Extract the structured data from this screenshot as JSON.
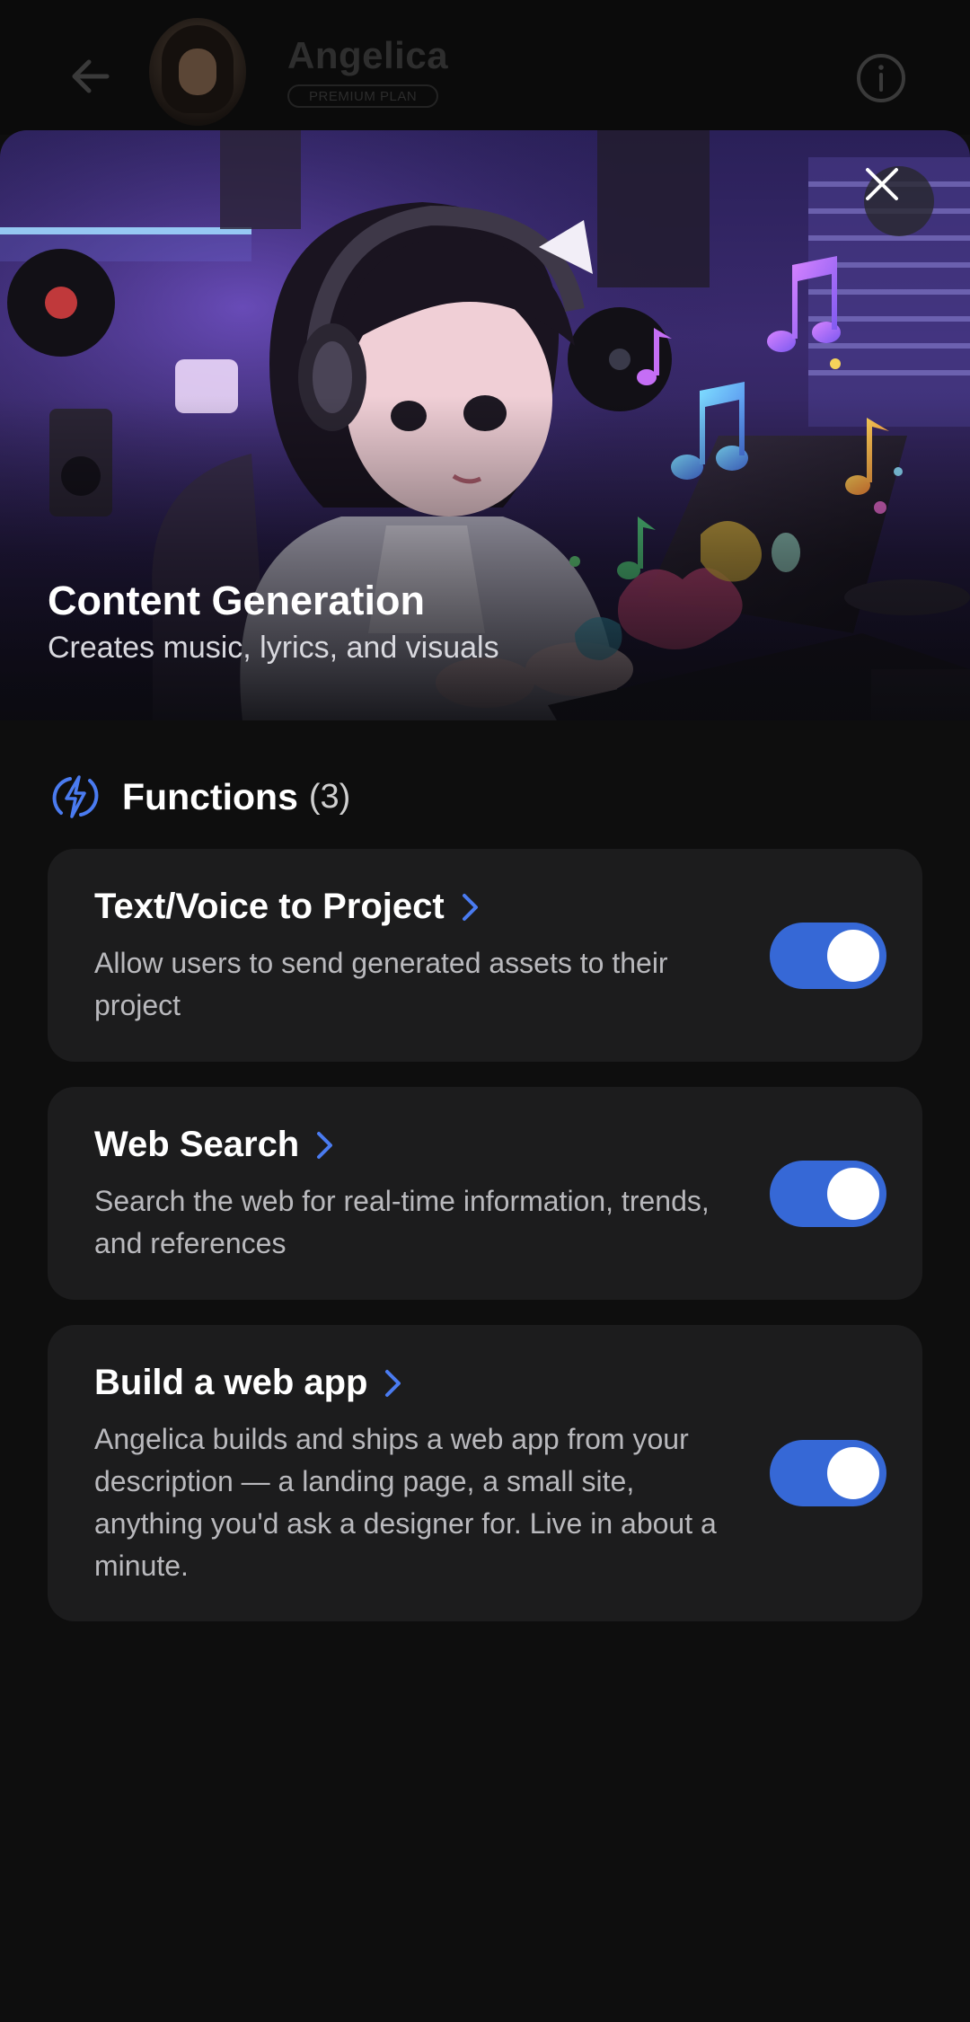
{
  "header": {
    "agent_name": "Angelica",
    "plan_badge": "PREMIUM PLAN",
    "back_icon": "arrow-left-icon",
    "info_icon": "info-icon"
  },
  "hero": {
    "title": "Content Generation",
    "subtitle": "Creates music, lyrics, and visuals",
    "close_icon": "close-icon"
  },
  "functions": {
    "title": "Functions",
    "count": "(3)",
    "icon": "lightning-icon",
    "items": [
      {
        "title": "Text/Voice to Project",
        "description": "Allow users to send generated assets to their project",
        "enabled": true
      },
      {
        "title": "Web Search",
        "description": "Search the web for real-time information, trends, and references",
        "enabled": true
      },
      {
        "title": "Build a web app",
        "description": "Angelica builds and ships a web app from your description — a landing page, a small site, anything you'd ask a designer for. Live in about a minute.",
        "enabled": true
      }
    ]
  },
  "colors": {
    "background": "#0e0e0e",
    "card": "#1c1c1d",
    "accent": "#3668d6",
    "chevron": "#4a7bf0"
  }
}
